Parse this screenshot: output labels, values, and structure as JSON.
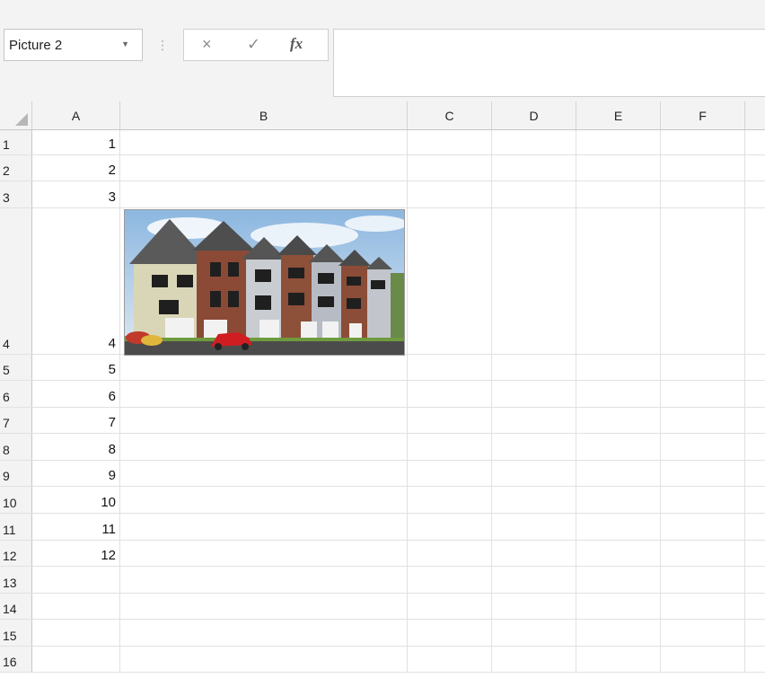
{
  "formula_bar": {
    "name_box_value": "Picture 2",
    "cancel_icon": "×",
    "enter_icon": "✓",
    "function_icon": "fx",
    "formula_value": ""
  },
  "columns": [
    "A",
    "B",
    "C",
    "D",
    "E",
    "F"
  ],
  "rows": [
    {
      "num": "1",
      "a": "1"
    },
    {
      "num": "2",
      "a": "2"
    },
    {
      "num": "3",
      "a": "3"
    },
    {
      "num": "4",
      "a": "4"
    },
    {
      "num": "5",
      "a": "5"
    },
    {
      "num": "6",
      "a": "6"
    },
    {
      "num": "7",
      "a": "7"
    },
    {
      "num": "8",
      "a": "8"
    },
    {
      "num": "9",
      "a": "9"
    },
    {
      "num": "10",
      "a": "10"
    },
    {
      "num": "11",
      "a": "11"
    },
    {
      "num": "12",
      "a": "12"
    },
    {
      "num": "13",
      "a": ""
    },
    {
      "num": "14",
      "a": ""
    },
    {
      "num": "15",
      "a": ""
    },
    {
      "num": "16",
      "a": ""
    }
  ],
  "picture": {
    "subject": "row of townhouses with red car",
    "sky_color": "#9fc3e6",
    "car_color": "#d01d22"
  }
}
